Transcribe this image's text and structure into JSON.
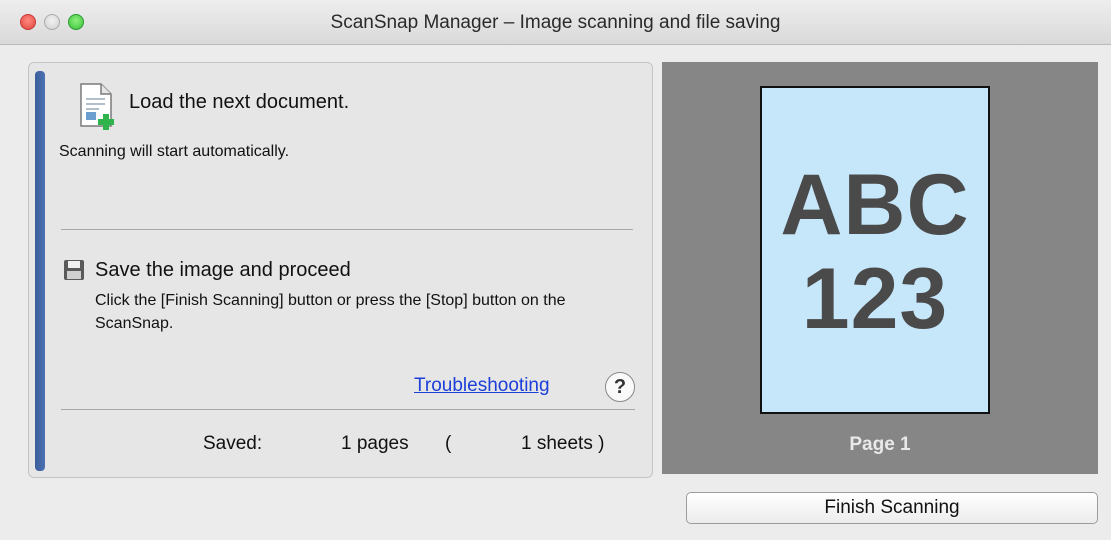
{
  "window": {
    "title": "ScanSnap Manager – Image scanning and file saving"
  },
  "steps": {
    "load": {
      "title": "Load the next document.",
      "description": "Scanning will start automatically.",
      "icon": "document-add-icon"
    },
    "save": {
      "title": "Save the image and proceed",
      "description": "Click the [Finish Scanning] button or press the [Stop] button on the ScanSnap.",
      "icon": "floppy-disk-icon"
    }
  },
  "help": {
    "troubleshooting_label": "Troubleshooting",
    "help_symbol": "?"
  },
  "status": {
    "saved_label": "Saved:",
    "pages": "1 pages",
    "paren_open": "(",
    "sheets": "1 sheets )"
  },
  "preview": {
    "line1": "ABC",
    "line2": "123",
    "page_label": "Page 1"
  },
  "buttons": {
    "finish_label": "Finish Scanning"
  },
  "colors": {
    "accent": "#3a5d9a",
    "link": "#1b3fd8",
    "preview_bg": "#868686",
    "page_bg": "#c6e6fa"
  }
}
